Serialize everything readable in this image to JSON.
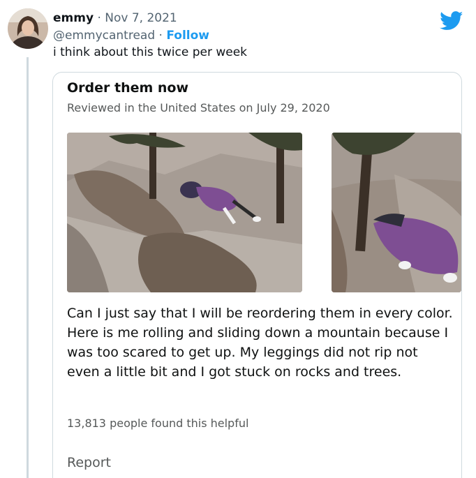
{
  "tweet": {
    "name": "emmy",
    "separator": "·",
    "date": "Nov 7, 2021",
    "handle": "@emmycantread",
    "follow_label": "Follow",
    "text": "i think about this twice per week"
  },
  "review": {
    "title": "Order them now",
    "meta": "Reviewed in the United States on July 29, 2020",
    "body": "Can I just say that I will be reordering them in every color. Here is me rolling and sliding down a mountain because I was too scared to get up. My leggings did not rip not even a little bit and I got stuck on rocks and trees.",
    "helpful": "13,813 people found this helpful",
    "report_label": "Report"
  },
  "icons": {
    "brand": "twitter-bird-icon",
    "brand_color": "#1d9bf0",
    "link_color": "#1d9bf0"
  }
}
